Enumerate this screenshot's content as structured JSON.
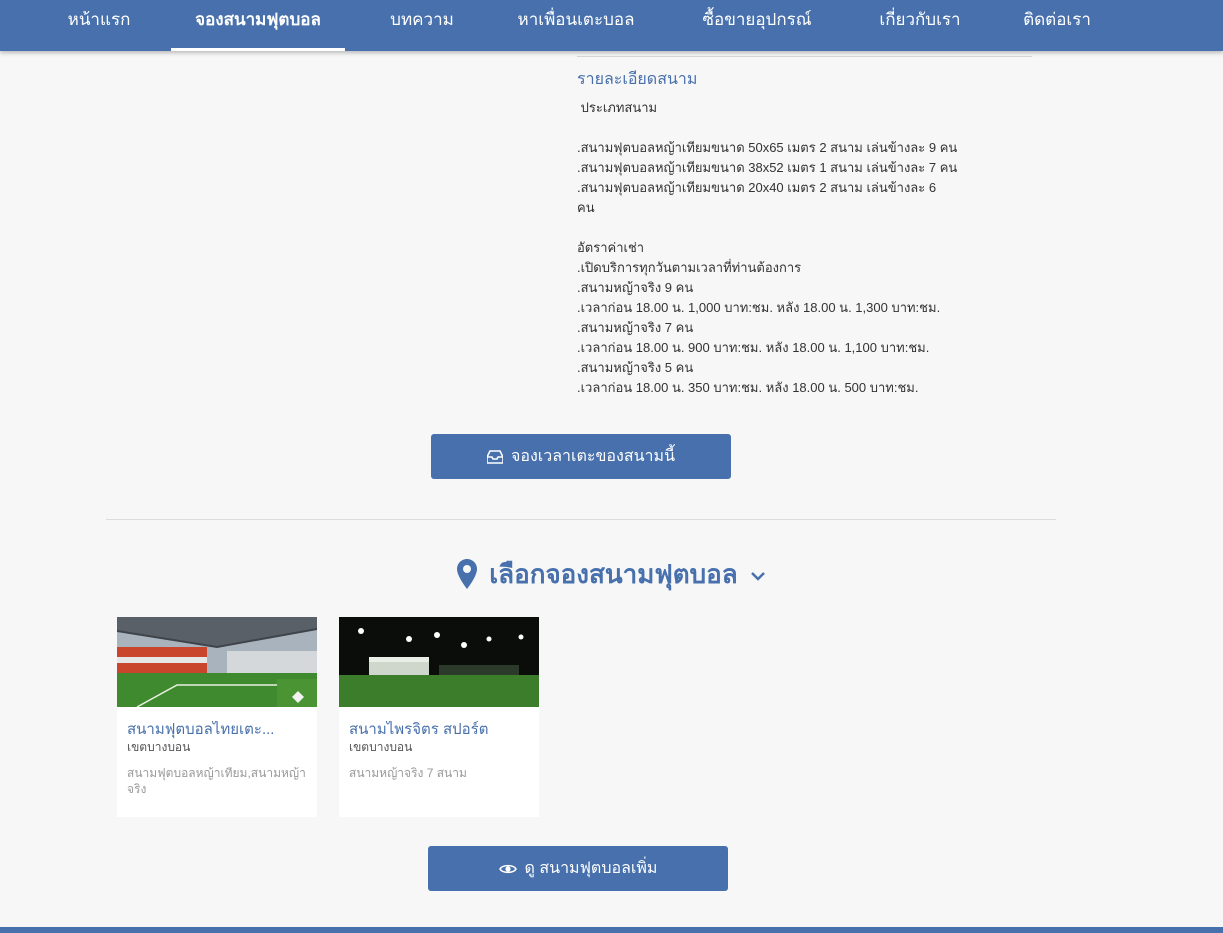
{
  "nav": {
    "items": [
      {
        "label": "หน้าแรก"
      },
      {
        "label": "จองสนามฟุตบอล"
      },
      {
        "label": "บทความ"
      },
      {
        "label": "หาเพื่อนเตะบอล"
      },
      {
        "label": "ซื้อขายอุปกรณ์"
      },
      {
        "label": "เกี่ยวกับเรา"
      },
      {
        "label": "ติดต่อเรา"
      }
    ],
    "active_index": 1
  },
  "detail": {
    "heading": "รายละเอียดสนาม",
    "body": " ประเภทสนาม\n\n.สนามฟุตบอลหญ้าเทียมขนาด 50x65 เมตร 2 สนาม เล่นข้างละ 9 คน\n.สนามฟุตบอลหญ้าเทียมขนาด 38x52 เมตร 1 สนาม เล่นข้างละ 7 คน\n.สนามฟุตบอลหญ้าเทียมขนาด 20x40 เมตร 2 สนาม เล่นข้างละ 6\nคน\n\nอัตราค่าเช่า\n.เปิดบริการทุกวันตามเวลาที่ท่านต้องการ\n.สนามหญ้าจริง 9 คน\n.เวลาก่อน 18.00 น. 1,000 บาท:ชม. หลัง 18.00 น. 1,300 บาท:ชม.\n.สนามหญ้าจริง 7 คน\n.เวลาก่อน 18.00 น. 900 บาท:ชม. หลัง 18.00 น. 1,100 บาท:ชม.\n.สนามหญ้าจริง 5 คน\n.เวลาก่อน 18.00 น. 350 บาท:ชม. หลัง 18.00 น. 500 บาท:ชม."
  },
  "book_button": {
    "label": "จองเวลาเตะของสนามนี้",
    "icon": "inbox-icon"
  },
  "section": {
    "title": "เลือกจองสนามฟุตบอล",
    "icon": "map-marker-icon",
    "toggle_icon": "chevron-down-icon"
  },
  "cards": [
    {
      "title": "สนามฟุตบอลไทยเตะ...",
      "district": "เขตบางบอน",
      "desc": "สนามฟุตบอลหญ้าเทียม,สนามหญ้าจริง"
    },
    {
      "title": "สนามไพรจิตร สปอร์ต",
      "district": "เขตบางบอน",
      "desc": "สนามหญ้าจริง 7 สนาม"
    }
  ],
  "more_button": {
    "label": "ดู สนามฟุตบอลเพิ่ม",
    "icon": "eye-icon"
  },
  "colors": {
    "brand": "#4770ac",
    "background": "#f7f7f7"
  }
}
